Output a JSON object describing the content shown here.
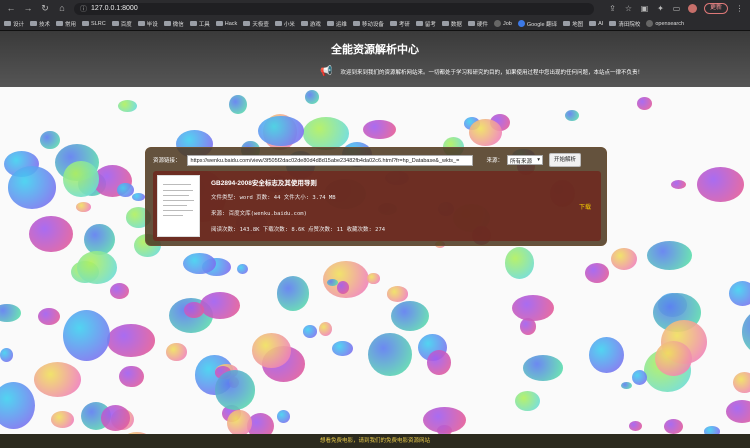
{
  "browser": {
    "url": "127.0.0.1:8000",
    "update_label": "更新"
  },
  "bookmarks": [
    "设计",
    "技术",
    "常用",
    "SLRC",
    "百度",
    "毕设",
    "微信",
    "工具",
    "Hack",
    "天极壹",
    "小米",
    "游戏",
    "运维",
    "移动设备",
    "考研",
    "留考",
    "数据",
    "硬件",
    "Job",
    "Google 翻译",
    "地图",
    "AI",
    "清田院校",
    "opensearch"
  ],
  "page": {
    "title": "全能资源解析中心",
    "welcome": "欢迎到来到我们的资源解析网站来。一切都处于学习和研究的目的，如果使用过程中您出现的任何问题，本站点一律不负责！",
    "footer": "想看免费电影，请到我们的免费电影资源网站"
  },
  "search": {
    "label": "资源链接：",
    "value": "https://wenku.baidu.com/view/3f505f2dac02de80d4d8d15abe23482fb4da02c6.html?fr=hp_Database&_wkts_=",
    "source_label": "来源：",
    "source_value": "所有来源",
    "button": "开始解析"
  },
  "result": {
    "title": "GB2894-2008安全标志及其使用导则",
    "type_line": "文件类型: word 页数: 44 文件大小: 3.74 MB",
    "source_line": "来源: 百度文库(wenku.baidu.com)",
    "stats_line": "阅读次数: 143.8K 下载次数: 8.6K 点赞次数: 11 收藏次数: 274",
    "download": "下载"
  }
}
